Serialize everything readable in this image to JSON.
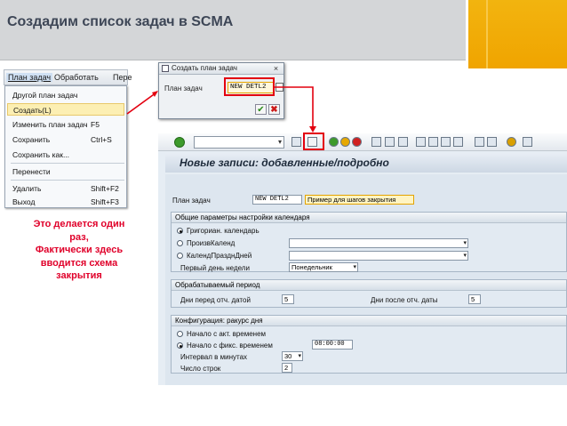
{
  "slide": {
    "title": "Создадим список задач в SCMA",
    "caption": "Это делается один раз,\nФактически здесь вводится схема закрытия"
  },
  "menu": {
    "bar": [
      "План задач",
      "Обработать",
      "Пере"
    ],
    "items": [
      {
        "label": "Другой план задач",
        "shortcut": ""
      },
      {
        "label": "Создать(L)",
        "shortcut": ""
      },
      {
        "label": "Изменить план задач",
        "shortcut": "F5"
      },
      {
        "label": "Сохранить",
        "shortcut": "Ctrl+S"
      },
      {
        "label": "Сохранить как...",
        "shortcut": ""
      },
      {
        "label": "Перенести",
        "shortcut": ""
      },
      {
        "label": "Удалить",
        "shortcut": "Shift+F2"
      },
      {
        "label": "Выход",
        "shortcut": "Shift+F3"
      }
    ]
  },
  "popup": {
    "title": "Создать план задач",
    "label": "План задач",
    "value": "NEW DETL2",
    "close": "×",
    "ok": "✔",
    "cancel": "✖"
  },
  "sap": {
    "title": "Новые записи: добавленные/подробно",
    "plan": {
      "label": "План задач",
      "code": "NEW DETL2",
      "desc": "Пример для шагов закрытия"
    },
    "calendar": {
      "title": "Общие параметры настройки календаря",
      "options": [
        "Григориан. календарь",
        "ПроизвКаленд",
        "КалендПразднДней"
      ],
      "selected": 0,
      "first_day_label": "Первый день недели",
      "first_day_value": "Понедельник"
    },
    "period": {
      "title": "Обрабатываемый период",
      "before_label": "Дни перед отч. датой",
      "before_value": "5",
      "after_label": "Дни после отч. даты",
      "after_value": "5"
    },
    "config": {
      "title": "Конфигурация: ракурс дня",
      "options": [
        "Начало с акт. временем",
        "Начало с фикс. временем"
      ],
      "selected": 1,
      "time_value": "08:00:00",
      "interval_label": "Интервал в минутах",
      "interval_value": "30",
      "rows_label": "Число строк",
      "rows_value": "2"
    }
  },
  "colors": {
    "accent": "#e3000f",
    "gold": "#f0a400",
    "header_bg": "#d4d6d8"
  }
}
